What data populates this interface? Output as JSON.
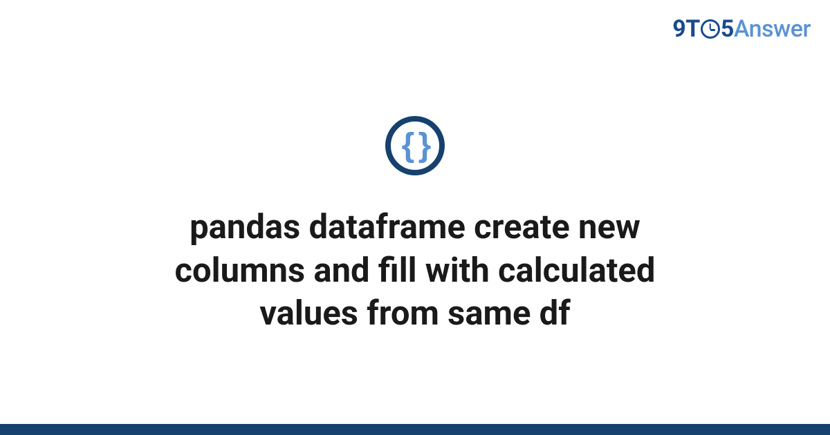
{
  "logo": {
    "part1": "9T",
    "part2": "5",
    "part3": "Answer"
  },
  "icon": {
    "name": "code-braces",
    "glyph": "{ }"
  },
  "title": "pandas dataframe create new columns and fill with calculated values from same df",
  "colors": {
    "dark_blue": "#16416f",
    "light_blue": "#5b92d4",
    "text": "#1a1a1a"
  }
}
